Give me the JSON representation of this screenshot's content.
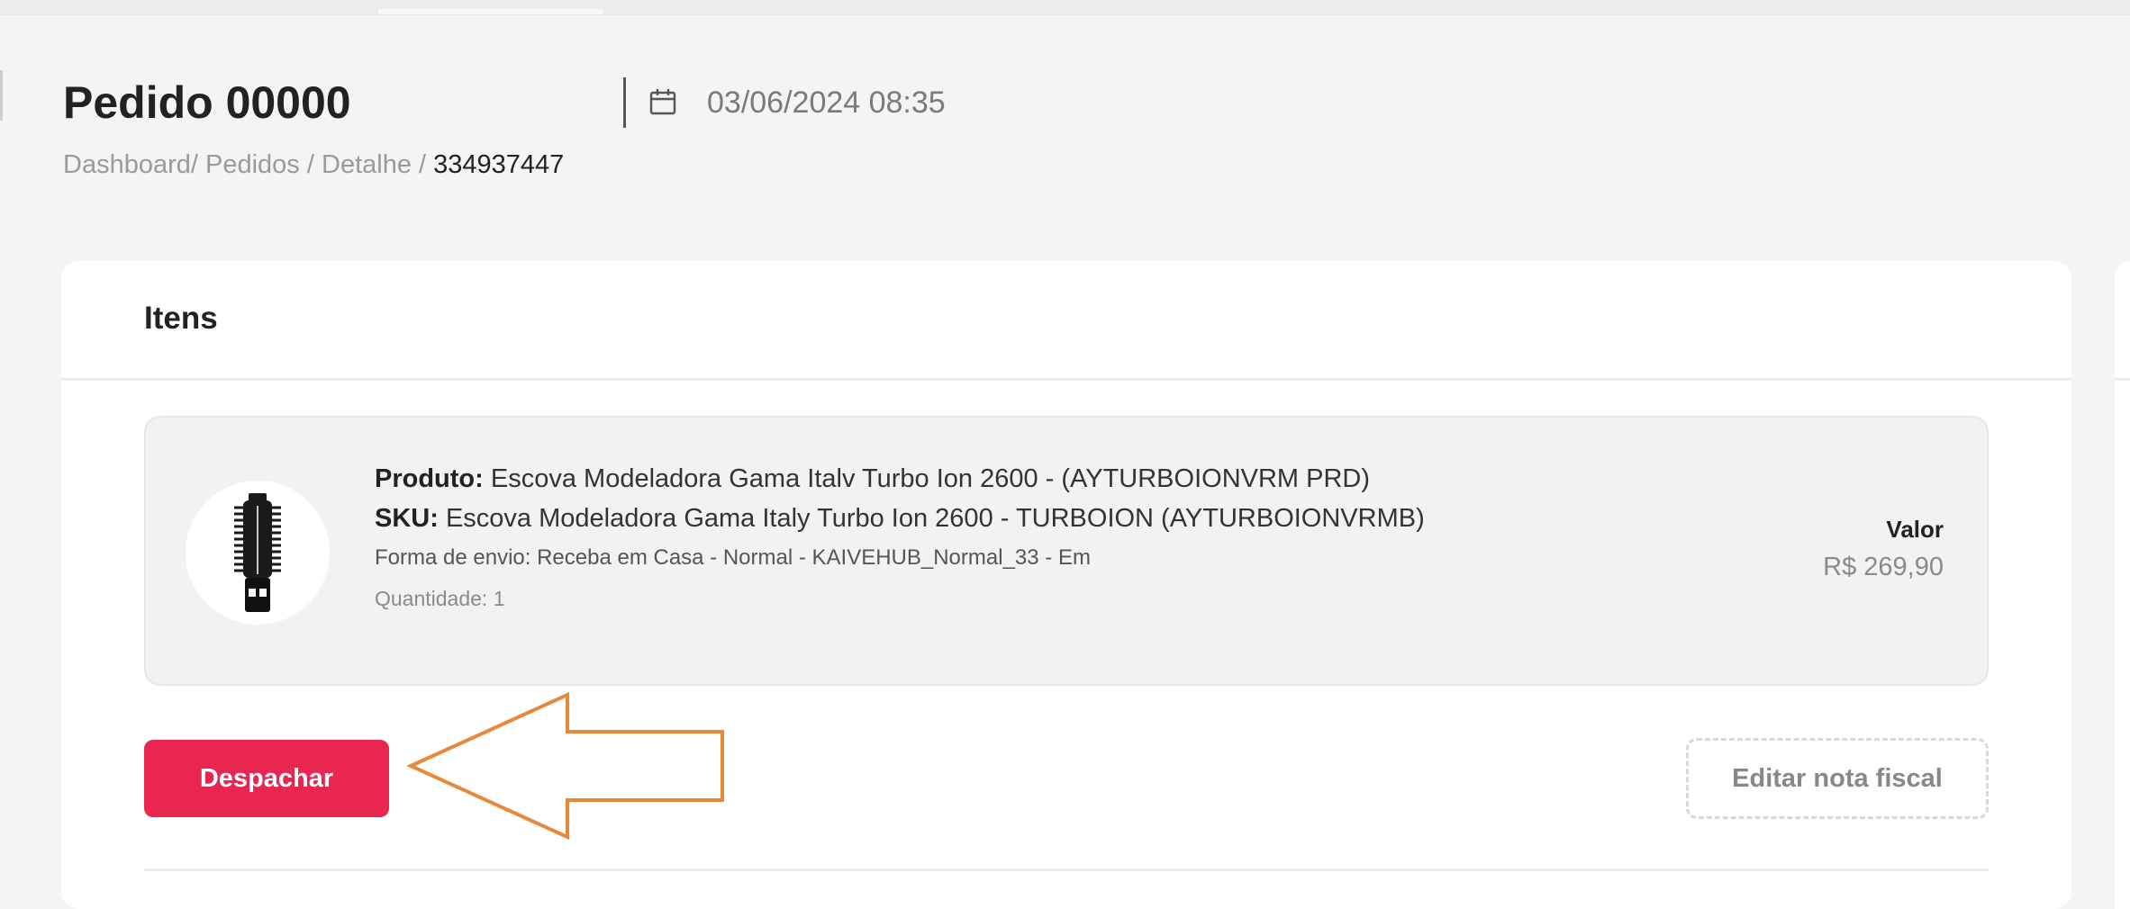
{
  "header": {
    "title": "Pedido 00000",
    "date": "03/06/2024 08:35",
    "breadcrumb": {
      "items": [
        "Dashboard",
        "Pedidos",
        "Detalhe"
      ],
      "separator": "/",
      "current": "334937447"
    }
  },
  "items_card": {
    "title": "Itens",
    "item": {
      "product_label": "Produto:",
      "product_value": "Escova Modeladora Gama Italv Turbo Ion 2600 -  (AYTURBOIONVRM PRD)",
      "sku_label": "SKU:",
      "sku_value": "Escova Modeladora Gama Italy Turbo Ion 2600 - TURBOION (AYTURBOIONVRMB)",
      "shipping": "Forma de envio: Receba em Casa - Normal - KAIVEHUB_Normal_33 - Em",
      "quantity": "Quantidade: 1",
      "value_label": "Valor",
      "value_amount": "R$ 269,90",
      "thumbnail_icon": "hair-brush-icon"
    },
    "actions": {
      "dispatch_label": "Despachar",
      "edit_invoice_label": "Editar nota fiscal"
    }
  },
  "annotation": {
    "arrow_color": "#e8883a",
    "arrow_direction": "left"
  },
  "colors": {
    "primary": "#e8264f",
    "background": "#f4f4f5",
    "card": "#ffffff",
    "item_box": "#f2f2f3"
  }
}
